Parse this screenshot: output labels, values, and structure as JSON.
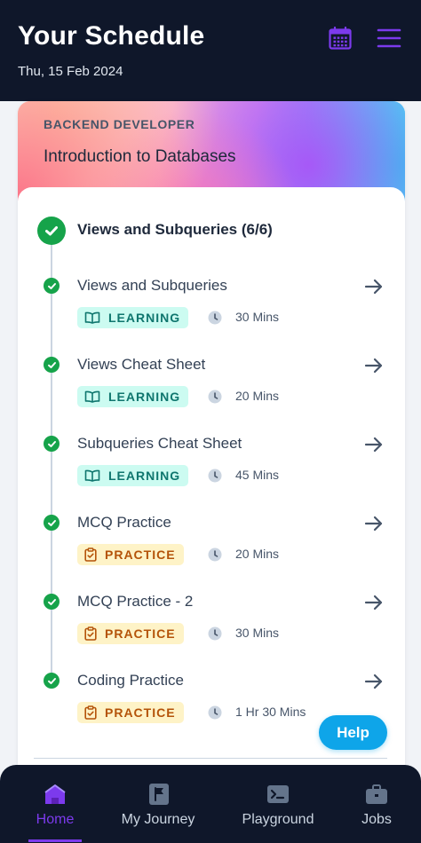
{
  "header": {
    "title": "Your Schedule",
    "date": "Thu, 15 Feb 2024",
    "calendar_icon": "calendar-icon",
    "menu_icon": "hamburger-menu-icon"
  },
  "course": {
    "track": "BACKEND DEVELOPER",
    "title": "Introduction to Databases",
    "section_title": "Views and Subqueries (6/6)",
    "items": [
      {
        "name": "Views and Subqueries",
        "type": "LEARNING",
        "duration": "30 Mins"
      },
      {
        "name": "Views Cheat Sheet",
        "type": "LEARNING",
        "duration": "20 Mins"
      },
      {
        "name": "Subqueries Cheat Sheet",
        "type": "LEARNING",
        "duration": "45 Mins"
      },
      {
        "name": "MCQ Practice",
        "type": "PRACTICE",
        "duration": "20 Mins"
      },
      {
        "name": "MCQ Practice - 2",
        "type": "PRACTICE",
        "duration": "30 Mins"
      },
      {
        "name": "Coding Practice",
        "type": "PRACTICE",
        "duration": "1 Hr 30 Mins"
      }
    ]
  },
  "help_button": "Help",
  "nav": {
    "items": [
      {
        "label": "Home",
        "icon": "home-icon",
        "active": true
      },
      {
        "label": "My Journey",
        "icon": "flag-icon",
        "active": false
      },
      {
        "label": "Playground",
        "icon": "terminal-icon",
        "active": false
      },
      {
        "label": "Jobs",
        "icon": "briefcase-icon",
        "active": false
      }
    ]
  },
  "colors": {
    "header_bg": "#0f172a",
    "accent": "#7c3aed",
    "completed": "#16a34a",
    "learning_tag": "#ccfbf1",
    "practice_tag": "#fef3c7",
    "help_button": "#0ea5e9"
  }
}
